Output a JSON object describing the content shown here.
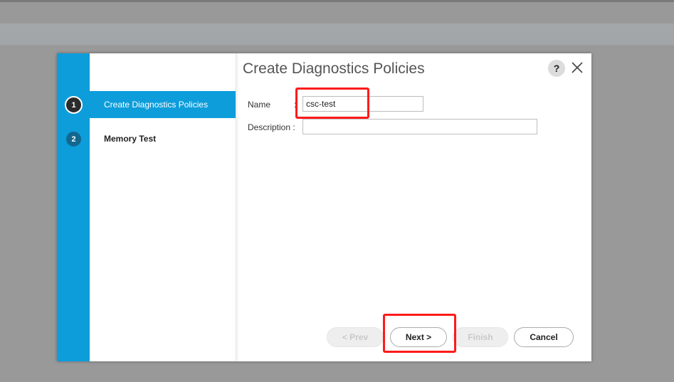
{
  "dialog": {
    "title": "Create Diagnostics Policies",
    "help_label": "?",
    "icons": {
      "help": "help-icon",
      "close": "close-icon"
    }
  },
  "wizard": {
    "steps": [
      {
        "number": "1",
        "label": "Create Diagnostics Policies",
        "active": true
      },
      {
        "number": "2",
        "label": "Memory Test",
        "active": false
      }
    ]
  },
  "form": {
    "name_label": "Name",
    "name_colon": ":",
    "name_value": "csc-test",
    "description_label": "Description :",
    "description_value": ""
  },
  "buttons": {
    "prev": "< Prev",
    "next": "Next >",
    "finish": "Finish",
    "cancel": "Cancel"
  },
  "colors": {
    "accent": "#0d9ddb",
    "highlight": "#ff1a1a",
    "overlay": "#999999"
  }
}
